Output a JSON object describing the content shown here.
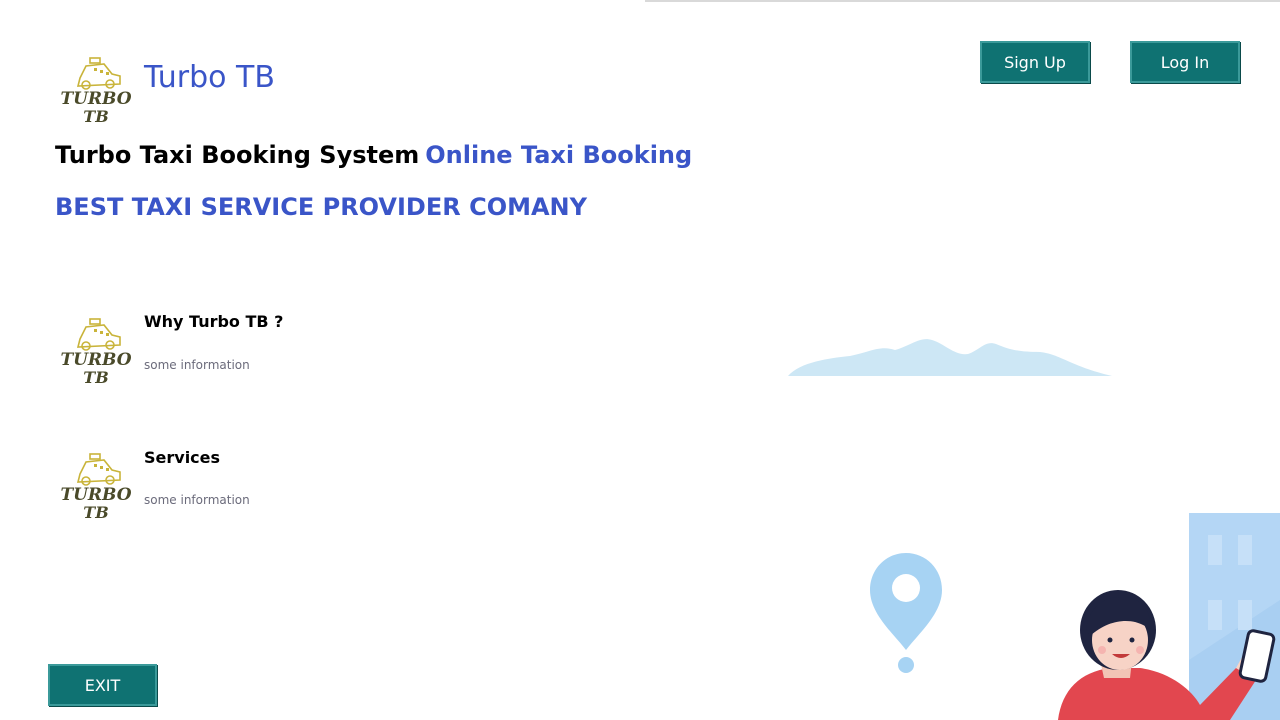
{
  "header": {
    "brand_name": "Turbo TB",
    "logo_text_top": "TURBO",
    "logo_text_bottom": "TB",
    "signup_label": "Sign Up",
    "login_label": "Log In"
  },
  "hero": {
    "system_name": "Turbo Taxi Booking System",
    "system_tag": "Online Taxi Booking",
    "subheading": "BEST TAXI SERVICE PROVIDER COMANY"
  },
  "features": [
    {
      "title": "Why Turbo TB ?",
      "info": "some information"
    },
    {
      "title": "Services",
      "info": "some information"
    }
  ],
  "footer": {
    "exit_label": "EXIT"
  },
  "colors": {
    "accent_blue": "#3a55c8",
    "button_teal": "#0f7272",
    "cloud": "#cde7f5",
    "pin": "#a7d3f3",
    "building": "#a9cff2",
    "person_shirt": "#e2474f"
  }
}
